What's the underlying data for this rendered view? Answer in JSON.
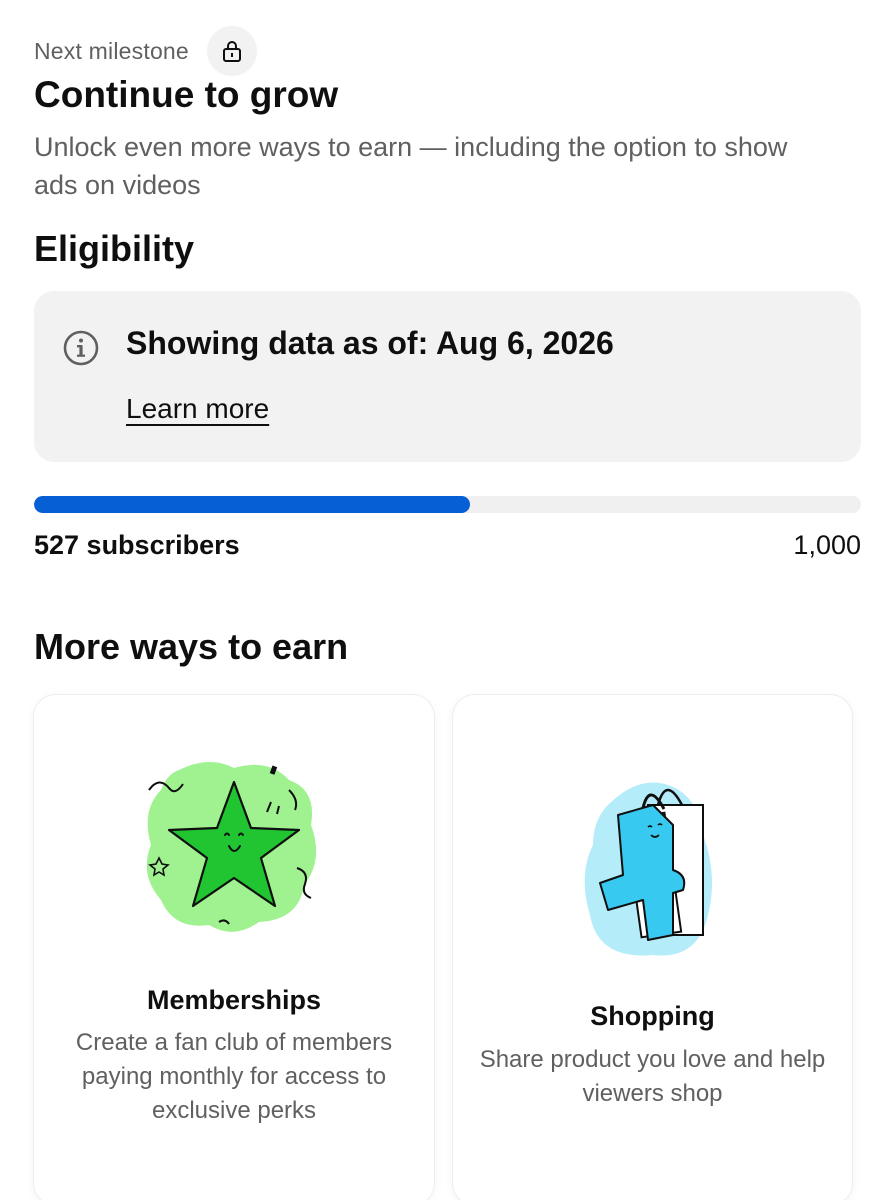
{
  "milestone": {
    "label": "Next milestone",
    "lock_icon": "lock-icon"
  },
  "header": {
    "title": "Continue to grow",
    "subtitle": "Unlock even more ways to earn — including the option to show ads on videos"
  },
  "eligibility": {
    "title": "Eligibility",
    "info_icon": "info-icon",
    "data_as_of": "Showing data as of: Aug 6, 2026",
    "learn_more": "Learn more"
  },
  "progress": {
    "current_label": "527 subscribers",
    "goal_label": "1,000",
    "current": 527,
    "goal": 1000,
    "fill_color": "#065fd4"
  },
  "more_ways": {
    "title": "More ways to earn",
    "cards": [
      {
        "title": "Memberships",
        "description": "Create a fan club of members paying monthly for access to exclusive perks",
        "illustration": "star-illustration",
        "accent_color": "#1fcc33"
      },
      {
        "title": "Shopping",
        "description": "Share product you love and help viewers shop",
        "illustration": "shopping-bag-illustration",
        "accent_color": "#37c9ef"
      }
    ]
  }
}
